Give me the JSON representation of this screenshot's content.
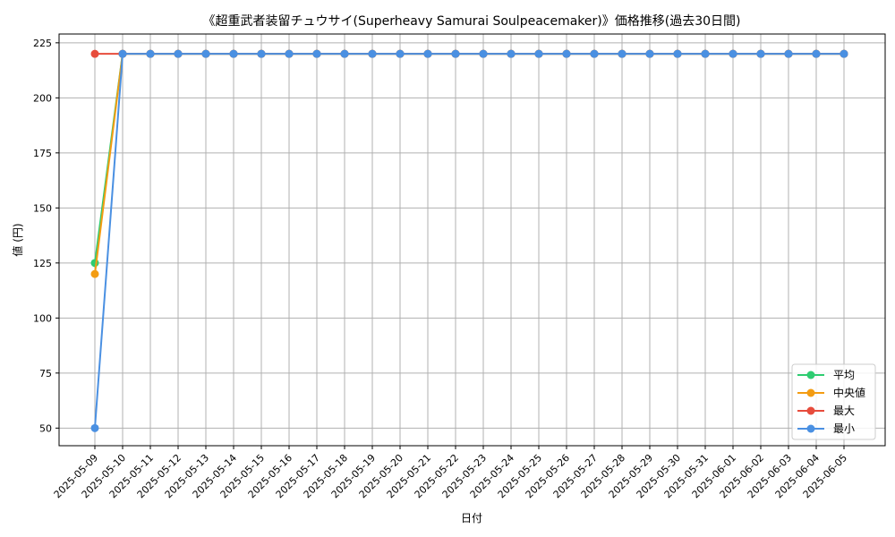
{
  "chart_data": {
    "type": "line",
    "title": "《超重武者装留チュウサイ(Superheavy Samurai Soulpeacemaker)》価格推移(過去30日間)",
    "xlabel": "日付",
    "ylabel": "値 (円)",
    "ylim": [
      42,
      229
    ],
    "yticks": [
      50,
      75,
      100,
      125,
      150,
      175,
      200,
      225
    ],
    "grid": true,
    "legend_position": "bottom-right",
    "categories": [
      "2025-05-09",
      "2025-05-10",
      "2025-05-11",
      "2025-05-12",
      "2025-05-13",
      "2025-05-14",
      "2025-05-15",
      "2025-05-16",
      "2025-05-17",
      "2025-05-18",
      "2025-05-19",
      "2025-05-20",
      "2025-05-21",
      "2025-05-22",
      "2025-05-23",
      "2025-05-24",
      "2025-05-25",
      "2025-05-26",
      "2025-05-27",
      "2025-05-28",
      "2025-05-29",
      "2025-05-30",
      "2025-05-31",
      "2025-06-01",
      "2025-06-02",
      "2025-06-03",
      "2025-06-04",
      "2025-06-05"
    ],
    "series": [
      {
        "name": "平均",
        "color": "#2ecc71",
        "values": [
          125,
          220,
          220,
          220,
          220,
          220,
          220,
          220,
          220,
          220,
          220,
          220,
          220,
          220,
          220,
          220,
          220,
          220,
          220,
          220,
          220,
          220,
          220,
          220,
          220,
          220,
          220,
          220
        ]
      },
      {
        "name": "中央値",
        "color": "#f39c12",
        "values": [
          120,
          220,
          220,
          220,
          220,
          220,
          220,
          220,
          220,
          220,
          220,
          220,
          220,
          220,
          220,
          220,
          220,
          220,
          220,
          220,
          220,
          220,
          220,
          220,
          220,
          220,
          220,
          220
        ]
      },
      {
        "name": "最大",
        "color": "#e74c3c",
        "values": [
          220,
          220,
          220,
          220,
          220,
          220,
          220,
          220,
          220,
          220,
          220,
          220,
          220,
          220,
          220,
          220,
          220,
          220,
          220,
          220,
          220,
          220,
          220,
          220,
          220,
          220,
          220,
          220
        ]
      },
      {
        "name": "最小",
        "color": "#4a90e2",
        "values": [
          50,
          220,
          220,
          220,
          220,
          220,
          220,
          220,
          220,
          220,
          220,
          220,
          220,
          220,
          220,
          220,
          220,
          220,
          220,
          220,
          220,
          220,
          220,
          220,
          220,
          220,
          220,
          220
        ]
      }
    ]
  }
}
